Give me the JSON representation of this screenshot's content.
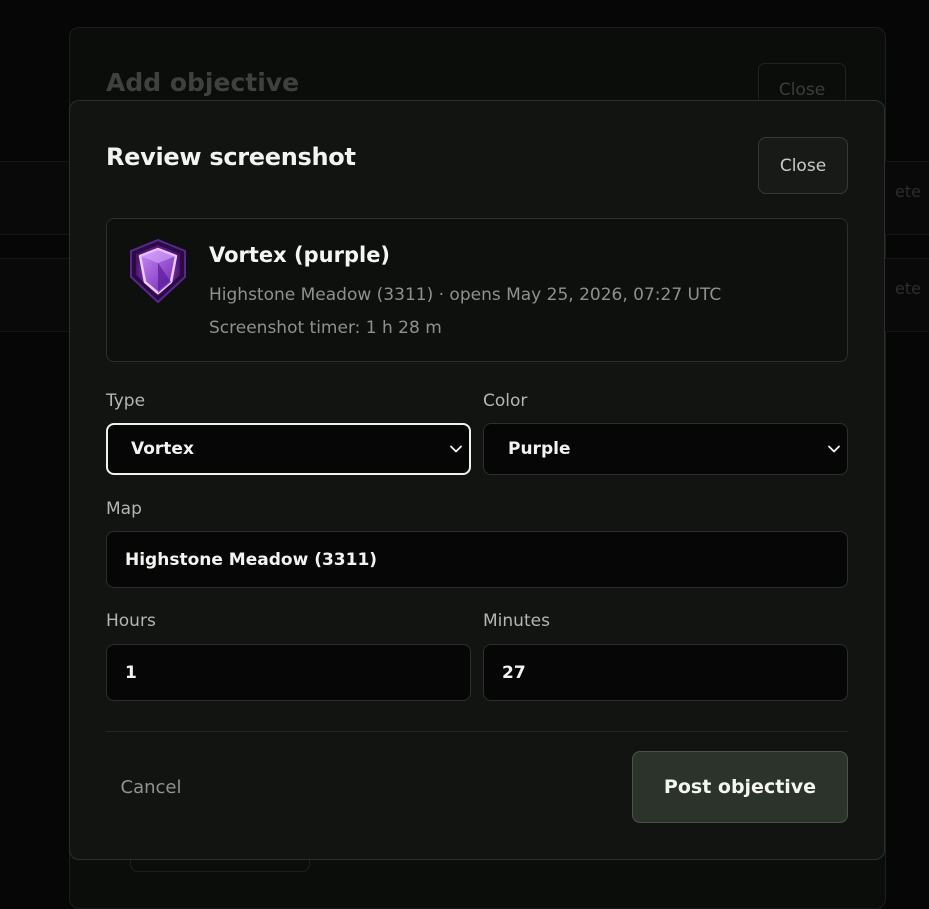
{
  "background": {
    "title": "Add objective",
    "close_label": "Close",
    "row_labels": [
      "ete",
      "ete"
    ]
  },
  "modal": {
    "title": "Review screenshot",
    "close_label": "Close",
    "summary": {
      "icon": "purple-gem-icon",
      "name": "Vortex (purple)",
      "meta": "Highstone Meadow (3311) · opens May 25, 2026, 07:27 UTC",
      "timer": "Screenshot timer: 1 h 28 m"
    },
    "form": {
      "type_label": "Type",
      "type_value": "Vortex",
      "color_label": "Color",
      "color_value": "Purple",
      "map_label": "Map",
      "map_value": "Highstone Meadow (3311)",
      "hours_label": "Hours",
      "hours_value": "1",
      "minutes_label": "Minutes",
      "minutes_value": "27"
    },
    "footer": {
      "cancel_label": "Cancel",
      "post_label": "Post objective"
    }
  },
  "colors": {
    "gem_purple": "#9b3fe0",
    "gem_edge": "#e6b3ff",
    "button_bg": "#2b332b"
  }
}
